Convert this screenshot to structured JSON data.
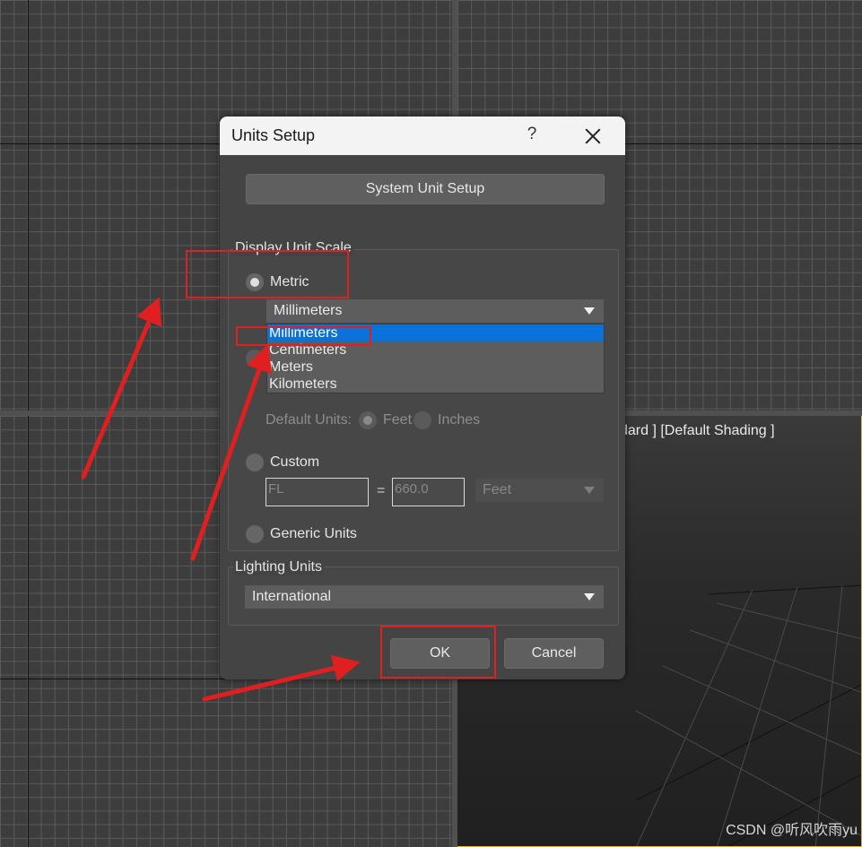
{
  "viewport": {
    "label": "dard ] [Default Shading ]",
    "watermark": "CSDN @听风吹雨yu"
  },
  "dialog": {
    "title": "Units Setup",
    "help_label": "?",
    "system_unit_setup_label": "System Unit Setup",
    "display_unit_scale": {
      "group_label": "Display Unit Scale",
      "metric_label": "Metric",
      "metric_selected": "Millimeters",
      "metric_options": [
        "Millimeters",
        "Centimeters",
        "Meters",
        "Kilometers"
      ],
      "default_units_label": "Default Units:",
      "feet_label": "Feet",
      "inches_label": "Inches",
      "custom_label": "Custom",
      "custom_name": "FL",
      "equals": "=",
      "custom_value": "660.0",
      "custom_unit": "Feet",
      "generic_label": "Generic Units"
    },
    "lighting_units": {
      "group_label": "Lighting Units",
      "selected": "International"
    },
    "ok_label": "OK",
    "cancel_label": "Cancel"
  },
  "colors": {
    "annotation": "#e02020",
    "dropdown_highlight": "#0a72d8"
  }
}
